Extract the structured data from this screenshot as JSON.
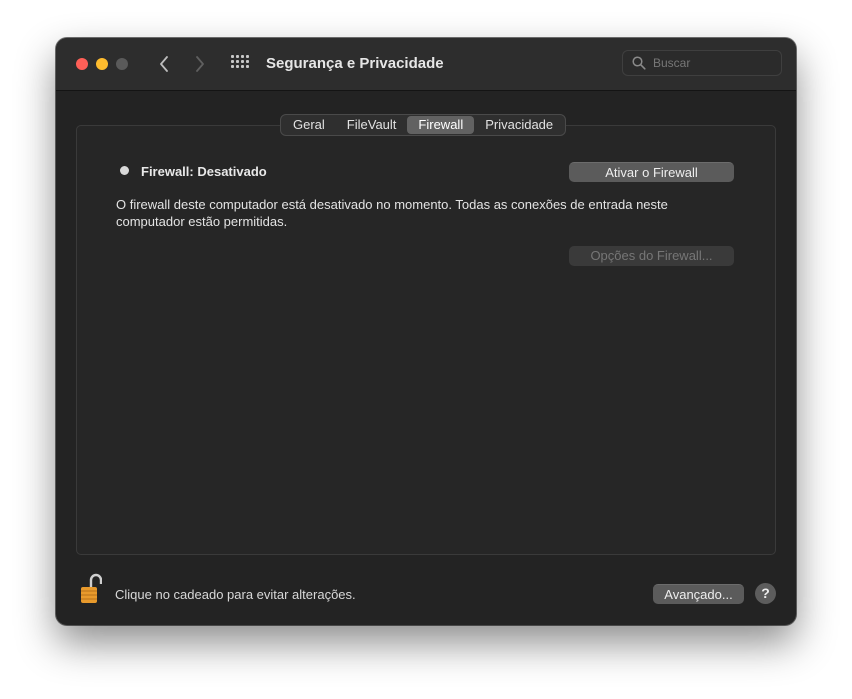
{
  "window": {
    "title": "Segurança e Privacidade"
  },
  "toolbar": {
    "back_icon": "chevron-left-icon",
    "forward_icon": "chevron-right-icon",
    "show_all_icon": "grid-icon"
  },
  "search": {
    "placeholder": "Buscar"
  },
  "tabs": [
    {
      "label": "Geral",
      "active": false
    },
    {
      "label": "FileVault",
      "active": false
    },
    {
      "label": "Firewall",
      "active": true
    },
    {
      "label": "Privacidade",
      "active": false
    }
  ],
  "firewall": {
    "status_label": "Firewall: Desativado",
    "turn_on_button": "Ativar o Firewall",
    "description": "O firewall deste computador está desativado no momento. Todas as conexões de entrada neste computador estão permitidas.",
    "options_button": "Opções do Firewall..."
  },
  "footer": {
    "lock_text": "Clique no cadeado para evitar alterações.",
    "advanced_button": "Avançado...",
    "help_button": "?"
  },
  "colors": {
    "window_bg": "#232323",
    "titlebar_bg": "#2d2d2d",
    "close": "#fe5f57",
    "minimize": "#febc2e",
    "zoom_inactive": "#5a5a5a",
    "active_tab": "#626262",
    "lock_body": "#e89a2c"
  }
}
